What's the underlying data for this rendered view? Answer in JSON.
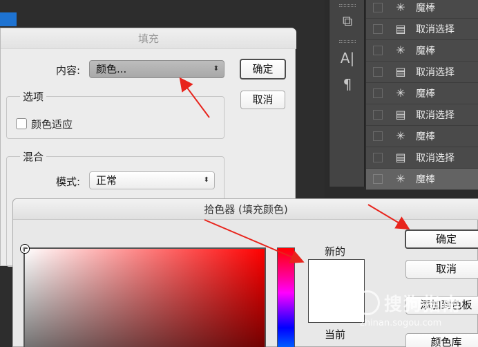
{
  "fill_dialog": {
    "title": "填充",
    "contents_label": "内容:",
    "contents_value": "颜色...",
    "ok": "确定",
    "cancel": "取消",
    "options_title": "选项",
    "color_adapt_label": "颜色适应",
    "blend_title": "混合",
    "mode_label": "模式:",
    "mode_value": "正常"
  },
  "tools": {
    "icons": [
      "clone-source-icon",
      "character-icon",
      "paragraph-icon"
    ],
    "glyphs": [
      "⧉",
      "A|",
      "¶"
    ]
  },
  "history": {
    "items": [
      {
        "label": "魔棒",
        "icon": "magic-wand-icon",
        "selected": false
      },
      {
        "label": "取消选择",
        "icon": "document-icon",
        "selected": false
      },
      {
        "label": "魔棒",
        "icon": "magic-wand-icon",
        "selected": false
      },
      {
        "label": "取消选择",
        "icon": "document-icon",
        "selected": false
      },
      {
        "label": "魔棒",
        "icon": "magic-wand-icon",
        "selected": false
      },
      {
        "label": "取消选择",
        "icon": "document-icon",
        "selected": false
      },
      {
        "label": "魔棒",
        "icon": "magic-wand-icon",
        "selected": false
      },
      {
        "label": "取消选择",
        "icon": "document-icon",
        "selected": false
      },
      {
        "label": "魔棒",
        "icon": "magic-wand-icon",
        "selected": true
      }
    ]
  },
  "color_picker": {
    "title": "拾色器 (填充颜色)",
    "new_label": "新的",
    "current_label": "当前",
    "ok": "确定",
    "cancel": "取消",
    "add_to_swatches": "添加到色板",
    "color_libraries": "颜色库",
    "new_color": "#ffffff",
    "hue_color": "#ff0000"
  },
  "watermark": {
    "text": "搜狗指南",
    "url": "zhinan.sogou.com"
  }
}
